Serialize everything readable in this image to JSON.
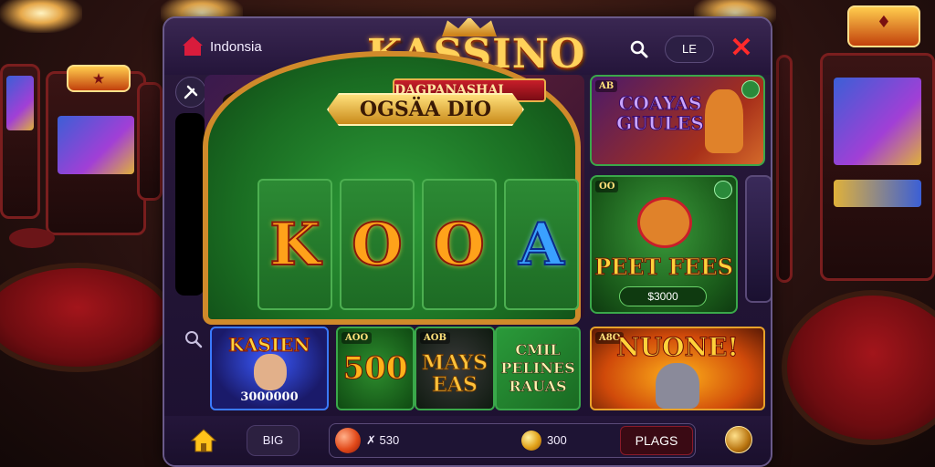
{
  "window": {
    "region_label": "Indonsia",
    "logo_title": "KASSINO",
    "logo_subtitle": "DAGPANASHAI",
    "lang_label": "LE"
  },
  "hero": {
    "banner": "OGSÄA DIO",
    "reels": [
      "K",
      "O",
      "O",
      "A"
    ]
  },
  "featured": [
    {
      "tag": "AB",
      "title": "COAYAS GUULES"
    },
    {
      "tag": "OO",
      "title": "PEET FEES",
      "amount": "$3000"
    }
  ],
  "games": [
    {
      "title": "KASIEN",
      "amount": "3000000"
    },
    {
      "tag": "AOO",
      "title": "500"
    },
    {
      "tag": "AOB",
      "title": "MAYS EAS"
    },
    {
      "title": "CMIL PELINES RAUAS"
    },
    {
      "tag": "A8O",
      "title": "NUONE!"
    }
  ],
  "bottom": {
    "big_label": "BIG",
    "balance_left": "✗ 530",
    "balance_right": "300",
    "play_label": "PLAGS"
  },
  "colors": {
    "accent_gold": "#ffd25a",
    "close_red": "#ff2a2a",
    "frame_green": "#2e9e3a",
    "window_bg": "#24153a"
  },
  "icons": [
    "home-icon",
    "search-icon",
    "close-icon",
    "tool-icon",
    "coin-icon",
    "menu-icon"
  ]
}
